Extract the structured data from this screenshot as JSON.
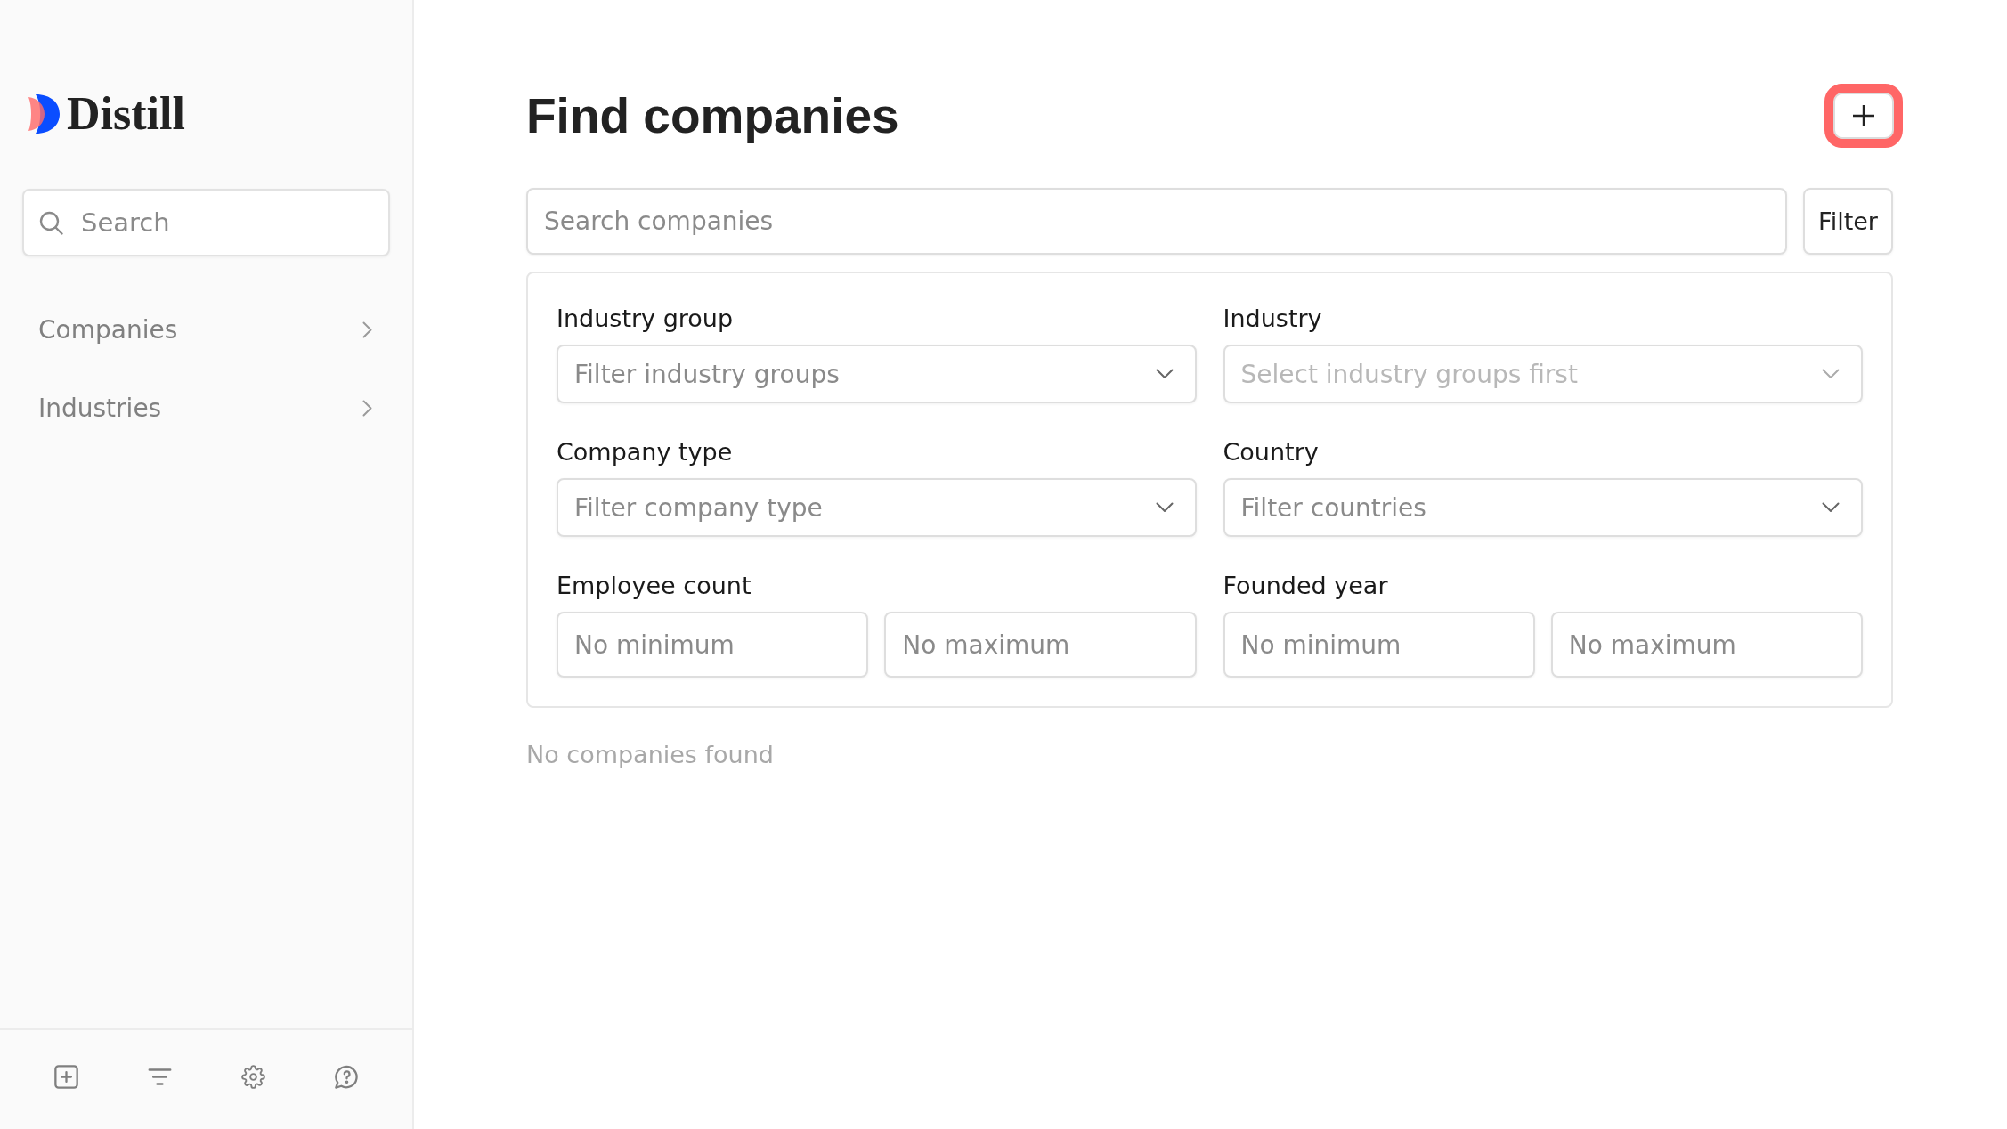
{
  "sidebar": {
    "logo": "Distill",
    "search": {
      "placeholder": "Search"
    },
    "items": [
      {
        "label": "Companies"
      },
      {
        "label": "Industries"
      }
    ]
  },
  "main": {
    "title": "Find companies",
    "add_button": {
      "highlighted": true
    },
    "search": {
      "placeholder": "Search companies"
    },
    "filter_button": "Filter",
    "filters": [
      {
        "kind": "select",
        "label": "Industry group",
        "placeholder": "Filter industry groups",
        "disabled": false
      },
      {
        "kind": "select",
        "label": "Industry",
        "placeholder": "Select industry groups first",
        "disabled": true
      },
      {
        "kind": "select",
        "label": "Company type",
        "placeholder": "Filter company type",
        "disabled": false
      },
      {
        "kind": "select",
        "label": "Country",
        "placeholder": "Filter countries",
        "disabled": false
      },
      {
        "kind": "range",
        "label": "Employee count",
        "min": {
          "placeholder": "No minimum"
        },
        "max": {
          "placeholder": "No maximum"
        }
      },
      {
        "kind": "range",
        "label": "Founded year",
        "min": {
          "placeholder": "No minimum"
        },
        "max": {
          "placeholder": "No maximum"
        }
      }
    ],
    "empty_message": "No companies found"
  }
}
